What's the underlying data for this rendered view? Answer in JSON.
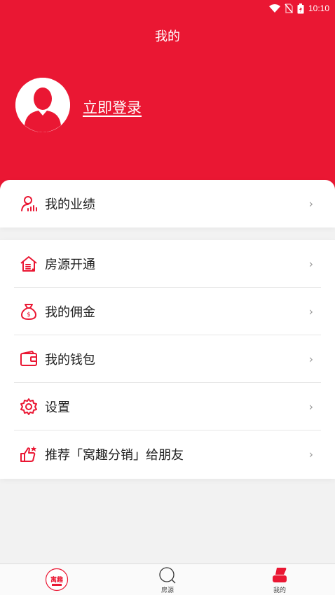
{
  "status_bar": {
    "time": "10:10"
  },
  "header": {
    "title": "我的",
    "login_label": "立即登录"
  },
  "performance_row": {
    "label": "我的业绩",
    "icon": "performance-icon"
  },
  "menu": {
    "items": [
      {
        "label": "房源开通",
        "icon": "house-icon"
      },
      {
        "label": "我的佣金",
        "icon": "money-bag-icon"
      },
      {
        "label": "我的钱包",
        "icon": "wallet-icon"
      },
      {
        "label": "设置",
        "icon": "gear-icon"
      },
      {
        "label": "推荐「窝趣分销」给朋友",
        "icon": "thumbs-up-icon"
      }
    ]
  },
  "tab_bar": {
    "home_logo_text": "寓趣",
    "tabs": [
      {
        "label": "房源",
        "icon": "search-icon"
      },
      {
        "label": "我的",
        "icon": "profile-icon"
      }
    ]
  },
  "colors": {
    "brand": "#ea1733",
    "background": "#f2f2f2"
  }
}
